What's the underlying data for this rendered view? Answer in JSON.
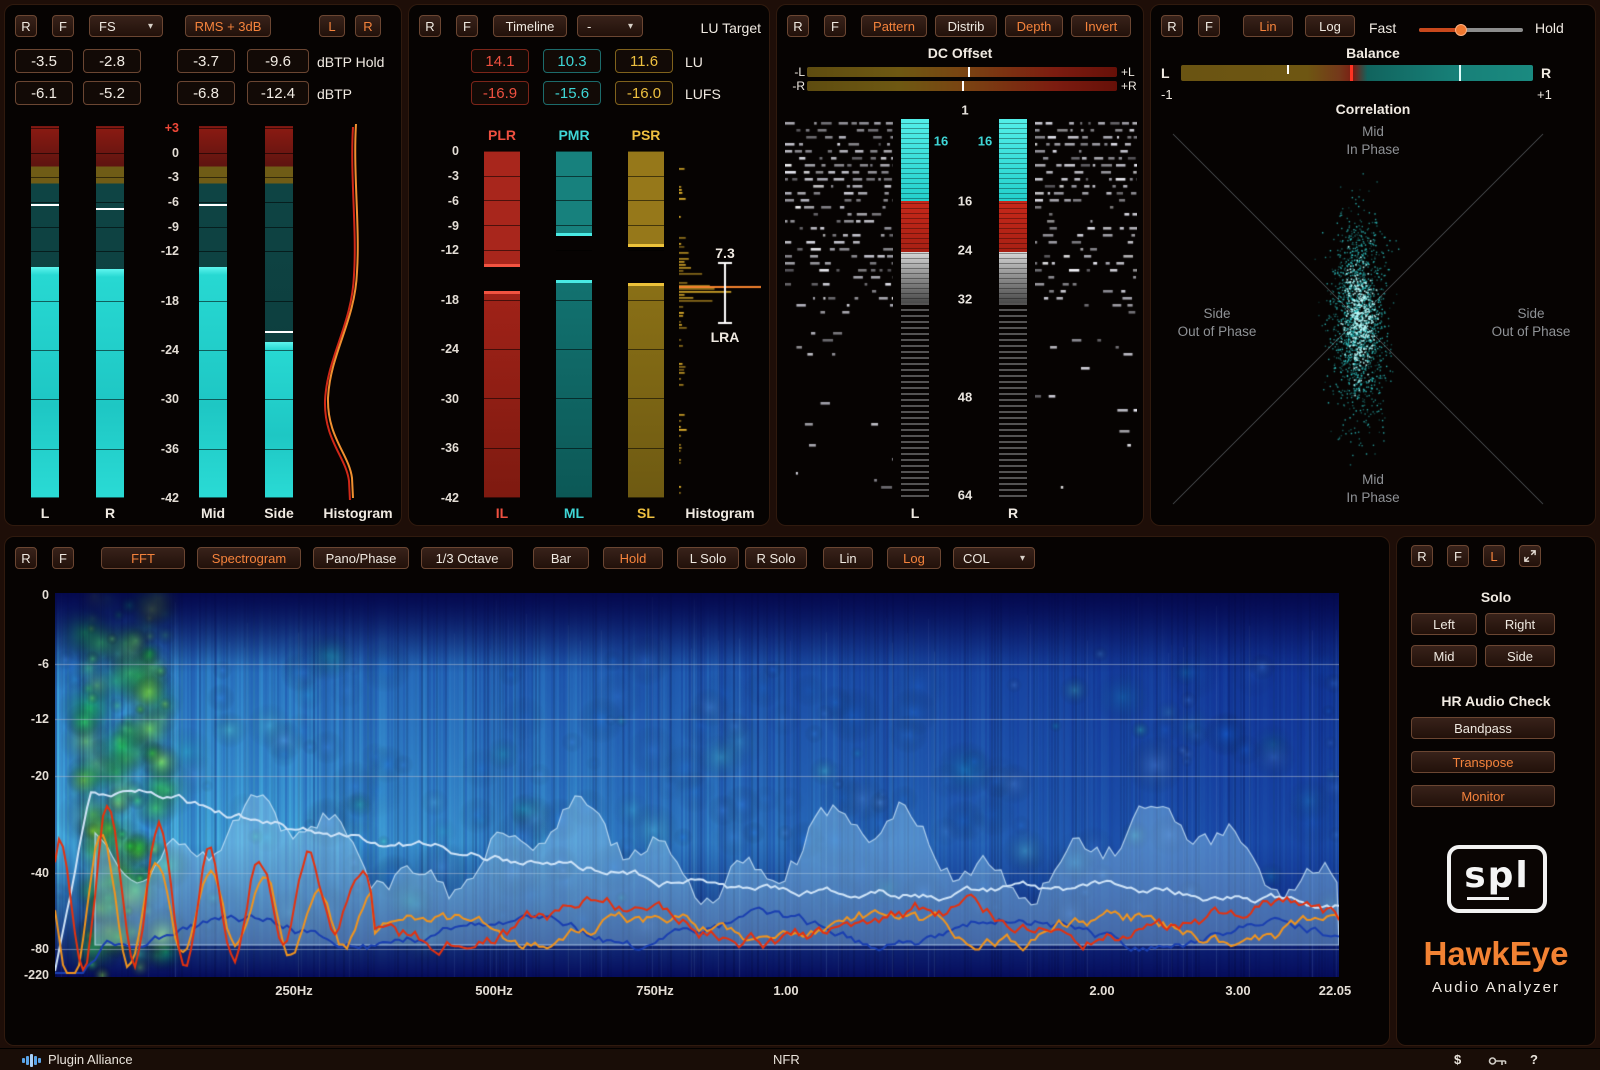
{
  "levels": {
    "btn_r": "R",
    "btn_f": "F",
    "btn_fs": "FS",
    "btn_rms": "RMS + 3dB",
    "btn_l": "L",
    "btn_r2": "R",
    "hold_values": [
      "-3.5",
      "-2.8",
      "-3.7",
      "-9.6"
    ],
    "hold_label": "dBTP Hold",
    "dbtp_values": [
      "-6.1",
      "-5.2",
      "-6.8",
      "-12.4"
    ],
    "dbtp_label": "dBTP",
    "scale": [
      "+3",
      "0",
      "-3",
      "-6",
      "-9",
      "-12",
      "-18",
      "-24",
      "-30",
      "-36",
      "-42"
    ],
    "channels": [
      "L",
      "R",
      "Mid",
      "Side"
    ],
    "hist_label": "Histogram"
  },
  "loudness": {
    "btn_r": "R",
    "btn_f": "F",
    "btn_timeline": "Timeline",
    "btn_mode": "-",
    "target_label": "LU Target",
    "lu_values": [
      "14.1",
      "10.3",
      "11.6"
    ],
    "lu_label": "LU",
    "lufs_values": [
      "-16.9",
      "-15.6",
      "-16.0"
    ],
    "lufs_label": "LUFS",
    "heads": [
      "PLR",
      "PMR",
      "PSR"
    ],
    "scale": [
      "0",
      "-3",
      "-6",
      "-9",
      "-12",
      "-18",
      "-24",
      "-30",
      "-36",
      "-42"
    ],
    "channels": [
      "IL",
      "ML",
      "SL"
    ],
    "lra_value": "7.3",
    "lra_label": "LRA",
    "hist_label": "Histogram"
  },
  "bits": {
    "btn_r": "R",
    "btn_f": "F",
    "btn_pattern": "Pattern",
    "btn_distrib": "Distrib",
    "btn_depth": "Depth",
    "btn_invert": "Invert",
    "dc_label": "DC Offset",
    "dc_lmin": "-L",
    "dc_lmax": "+L",
    "dc_rmin": "-R",
    "dc_rmax": "+R",
    "scale_top": "1",
    "scale": [
      "16",
      "24",
      "32",
      "48",
      "64"
    ],
    "depth_l": "16",
    "depth_r": "16",
    "ch_l": "L",
    "ch_r": "R"
  },
  "phase": {
    "btn_r": "R",
    "btn_f": "F",
    "btn_lin": "Lin",
    "btn_log": "Log",
    "fast_label": "Fast",
    "hold_label": "Hold",
    "balance_label": "Balance",
    "bal_l": "L",
    "bal_r": "R",
    "corr_min": "-1",
    "corr_max": "+1",
    "correlation_label": "Correlation",
    "quad_top_1": "Mid",
    "quad_top_2": "In Phase",
    "quad_left_1": "Side",
    "quad_left_2": "Out of Phase",
    "quad_right_1": "Side",
    "quad_right_2": "Out of Phase",
    "quad_bottom_1": "Mid",
    "quad_bottom_2": "In Phase"
  },
  "spectrum": {
    "btn_r": "R",
    "btn_f": "F",
    "tools": [
      "FFT",
      "Spectrogram",
      "Pano/Phase",
      "1/3 Octave",
      "Bar",
      "Hold",
      "L Solo",
      "R Solo",
      "Lin",
      "Log",
      "COL"
    ],
    "y_labels": [
      "0",
      "-6",
      "-12",
      "-20",
      "-40",
      "-80",
      "-220"
    ],
    "x_labels": [
      "250Hz",
      "500Hz",
      "750Hz",
      "1.00",
      "2.00",
      "3.00",
      "22.05"
    ]
  },
  "side": {
    "btn_r": "R",
    "btn_f": "F",
    "btn_l": "L",
    "solo_label": "Solo",
    "solo_buttons": [
      "Left",
      "Right",
      "Mid",
      "Side"
    ],
    "hr_label": "HR Audio Check",
    "hr_buttons": [
      "Bandpass",
      "Transpose",
      "Monitor"
    ],
    "logo_text": "spl",
    "brand": "HawkEye",
    "brand_sub": "Audio Analyzer"
  },
  "statusbar": {
    "brand": "Plugin Alliance",
    "center": "NFR",
    "dollar": "$",
    "help": "?"
  }
}
